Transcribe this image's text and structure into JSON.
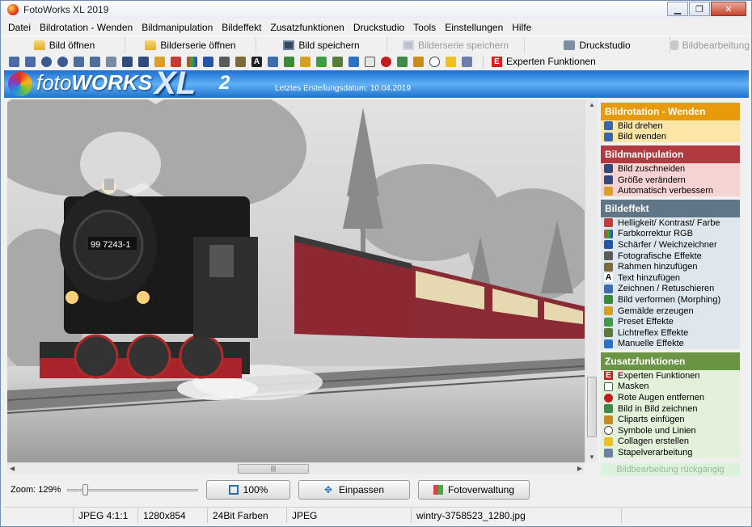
{
  "window": {
    "title": "FotoWorks XL 2019"
  },
  "menu": [
    "Datei",
    "Bildrotation - Wenden",
    "Bildmanipulation",
    "Bildeffekt",
    "Zusatzfunktionen",
    "Druckstudio",
    "Tools",
    "Einstellungen",
    "Hilfe"
  ],
  "toolbar": {
    "open": "Bild öffnen",
    "open_series": "Bilderserie öffnen",
    "save": "Bild speichern",
    "save_series": "Bilderserie speichern",
    "print": "Druckstudio",
    "edit": "Bildbearbeitung"
  },
  "toolbar2": {
    "expert": "Experten Funktionen"
  },
  "banner": {
    "logo_foto": "foto",
    "logo_works": "WORKS",
    "logo_xl": "XL",
    "logo_num": "2",
    "date_text": "Letztes Erstellungsdatum: 10.04.2019"
  },
  "sidebar": {
    "rotation": {
      "title": "Bildrotation - Wenden",
      "color": "#e89a0d",
      "bg": "#fbe6a8",
      "items": [
        "Bild drehen",
        "Bild wenden"
      ]
    },
    "manipulation": {
      "title": "Bildmanipulation",
      "color": "#b03a40",
      "bg": "#f5d3d3",
      "items": [
        "Bild zuschneiden",
        "Größe verändern",
        "Automatisch verbessern"
      ]
    },
    "effect": {
      "title": "Bildeffekt",
      "color": "#5f7686",
      "bg": "#dfe7ee",
      "items": [
        "Helligkeit/ Kontrast/ Farbe",
        "Farbkorrektur RGB",
        "Schärfer / Weichzeichner",
        "Fotografische Effekte",
        "Rahmen hinzufügen",
        "Text hinzufügen",
        "Zeichnen / Retuschieren",
        "Bild verformen (Morphing)",
        "Gemälde erzeugen",
        "Preset Effekte",
        "Lichtreflex Effekte",
        "Manuelle Effekte"
      ]
    },
    "extra": {
      "title": "Zusatzfunktionen",
      "color": "#6c9445",
      "bg": "#e3f0da",
      "items": [
        "Experten Funktionen",
        "Masken",
        "Rote Augen entfernen",
        "Bild in Bild zeichnen",
        "Cliparts einfügen",
        "Symbole und Linien",
        "Collagen erstellen",
        "Stapelverarbeitung"
      ]
    },
    "undo": "Bildbearbeitung rückgängig"
  },
  "bottom": {
    "zoom": "Zoom: 129%",
    "zoom_level": 0.12,
    "btn_100": "100%",
    "btn_fit": "Einpassen",
    "btn_manage": "Fotoverwaltung"
  },
  "status": {
    "format": "JPEG  4:1:1",
    "size": "1280x854",
    "depth": "24Bit Farben",
    "type": "JPEG",
    "file": "wintry-3758523_1280.jpg"
  },
  "photo": {
    "plate": "99 7243-1"
  }
}
